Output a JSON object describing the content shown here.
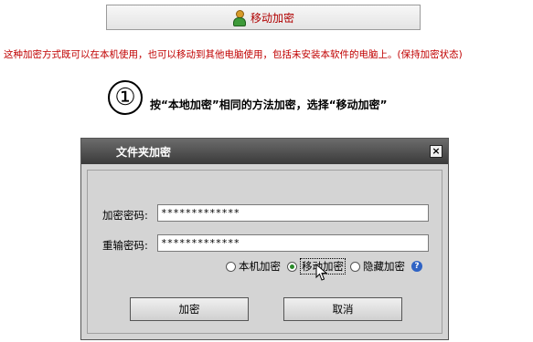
{
  "top_button": {
    "label": "移动加密",
    "icon": "user-icon"
  },
  "description": "这种加密方式既可以在本机使用，也可以移动到其他电脑使用，包括未安装本软件的电脑上。(保持加密状态)",
  "step": {
    "number": "①",
    "text": "按“本地加密”相同的方法加密，选择“移动加密”"
  },
  "dialog": {
    "title": "文件夹加密",
    "close_label": "×",
    "password_label": "加密密码:",
    "password_value": "*************",
    "confirm_label": "重输密码:",
    "confirm_value": "*************",
    "options": {
      "local": "本机加密",
      "mobile": "移动加密",
      "hidden": "隐藏加密",
      "selected": "移动加密"
    },
    "help_label": "?",
    "encrypt_button": "加密",
    "cancel_button": "取消"
  },
  "colors": {
    "accent_red": "#c00000",
    "title_bar": "#4a4a4a"
  }
}
